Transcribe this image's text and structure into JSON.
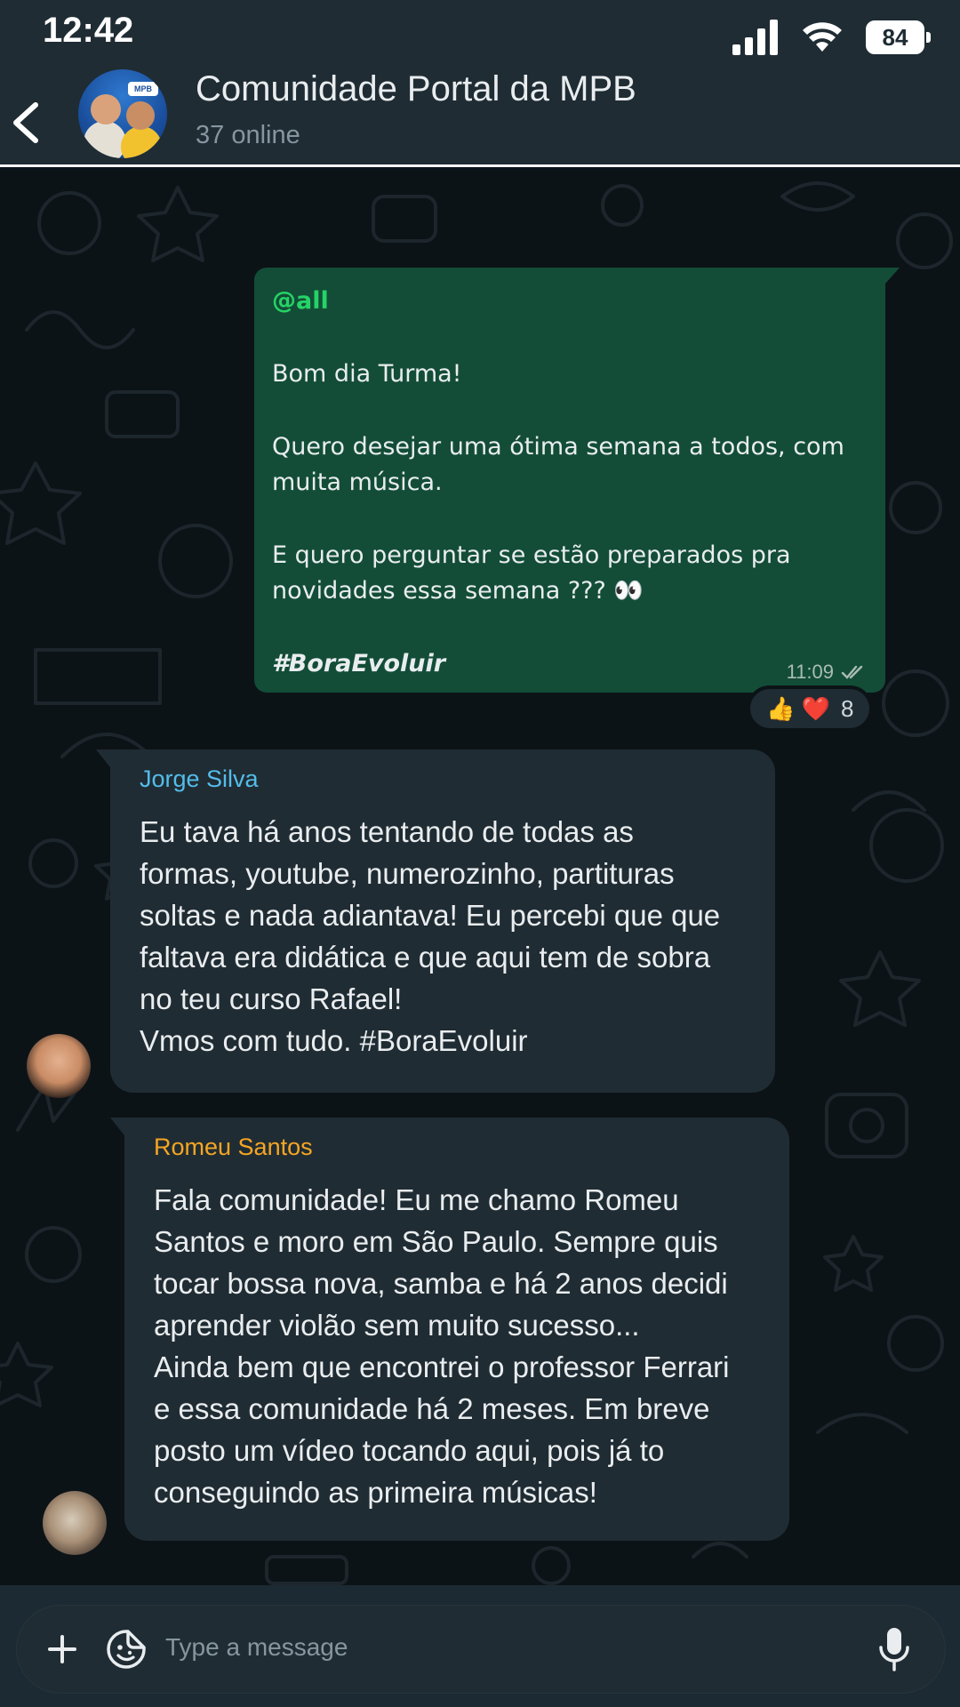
{
  "status_bar": {
    "time": "12:42",
    "battery": "84"
  },
  "header": {
    "title": "Comunidade Portal da MPB",
    "subtitle": "37 online",
    "avatar_logo_text": "MPB"
  },
  "messages": [
    {
      "direction": "outgoing",
      "mention": "@all",
      "lines": [
        "Bom dia Turma!",
        "Quero desejar uma ótima semana a todos, com",
        "muita música.",
        "E quero perguntar se estão preparados pra",
        "novidades essa semana ??? 👀"
      ],
      "hashtag": "#BoraEvoluir",
      "time": "11:09",
      "reactions": {
        "emojis": "👍 ❤️",
        "count": "8"
      }
    },
    {
      "direction": "incoming",
      "sender": "Jorge Silva",
      "sender_color": "#53bdeb",
      "lines": [
        "Eu tava há anos tentando de todas as",
        "formas, youtube, numerozinho, partituras",
        "soltas e nada adiantava! Eu percebi que que",
        "faltava era didática e que aqui tem de sobra",
        "no teu curso Rafael!",
        "Vmos com tudo. #BoraEvoluir"
      ]
    },
    {
      "direction": "incoming",
      "sender": "Romeu Santos",
      "sender_color": "#f5a623",
      "lines": [
        "Fala comunidade! Eu me chamo Romeu",
        "Santos e moro em São Paulo. Sempre quis",
        "tocar bossa nova, samba e há 2 anos decidi",
        "aprender violão sem muito sucesso...",
        "Ainda bem que encontrei o professor Ferrari",
        "e essa comunidade há 2 meses. Em breve",
        "posto um vídeo tocando aqui, pois já to",
        "conseguindo as primeira músicas!"
      ]
    }
  ],
  "composer": {
    "placeholder": "Type a message"
  },
  "colors": {
    "outgoing_bubble": "#134d37",
    "incoming_bubble": "#202c33",
    "mention": "#25d366",
    "header_bg": "#1f2c34"
  }
}
